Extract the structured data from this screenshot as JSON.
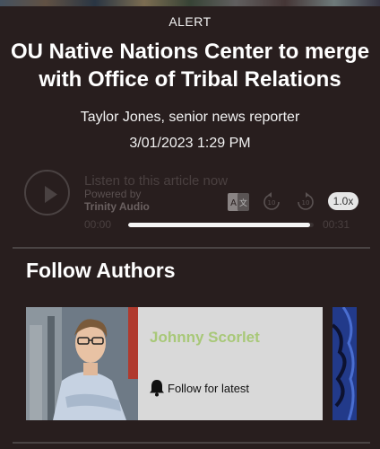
{
  "article": {
    "category": "ALERT",
    "headline": "OU Native Nations Center to merge with Office of Tribal Relations",
    "byline": "Taylor Jones, senior news reporter",
    "date": "3/01/2023 1:29 PM"
  },
  "audio_player": {
    "prompt": "Listen to this article now",
    "powered_by": "Powered by",
    "provider": "Trinity Audio",
    "current_time": "00:00",
    "duration": "00:31",
    "speed": "1.0x",
    "progress": 0.98,
    "icons": [
      "play-icon",
      "translate-icon",
      "rewind-10-icon",
      "forward-10-icon"
    ]
  },
  "follow_authors": {
    "title": "Follow Authors",
    "authors": [
      {
        "name": "Johnny Scorlet",
        "follow_label": "Follow for latest"
      }
    ]
  },
  "colors": {
    "background": "#281e1e",
    "author_name": "#a8c878",
    "card": "#d9d9d9"
  }
}
